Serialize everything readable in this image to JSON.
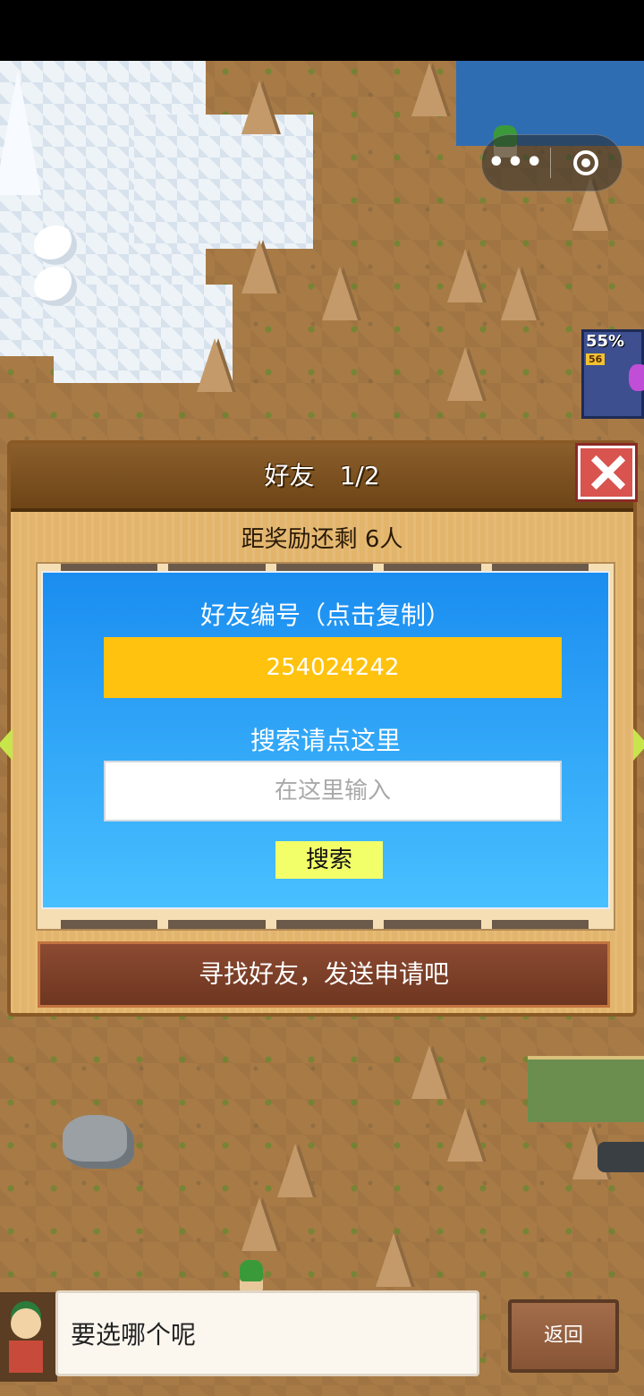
{
  "capsule": {
    "more_icon": "more-dots-icon",
    "close_icon": "target-circle-icon"
  },
  "side_widget": {
    "percent": "55%",
    "level": "56"
  },
  "dialog": {
    "title": "好友　1/2",
    "reward_text": "距奖励还剩 6人",
    "friend_id_label": "好友编号（点击复制）",
    "friend_id": "254024242",
    "search_label": "搜索请点这里",
    "search_placeholder": "在这里输入",
    "search_button": "搜索",
    "find_button": "寻找好友，发送申请吧"
  },
  "bottom": {
    "speech": "要选哪个呢",
    "back_button": "返回"
  },
  "colors": {
    "id_box": "#ffc20e",
    "search_button": "#f3ff69",
    "panel_top": "#1a8df0",
    "panel_bottom": "#48c0ff",
    "close_button": "#d9534f"
  }
}
